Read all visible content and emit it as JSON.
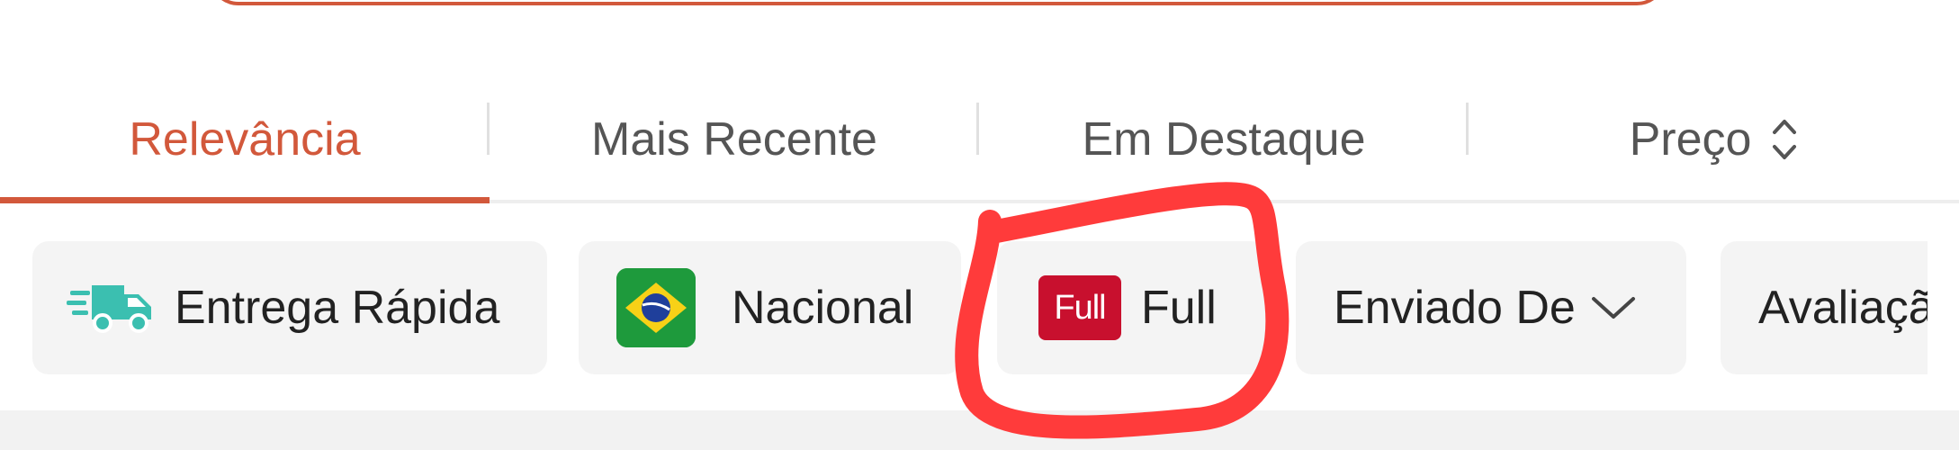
{
  "sort_tabs": {
    "items": [
      {
        "label": "Relevância",
        "active": true
      },
      {
        "label": "Mais Recente",
        "active": false
      },
      {
        "label": "Em Destaque",
        "active": false
      },
      {
        "label": "Preço",
        "active": false,
        "icon": "sort-updown-icon"
      }
    ]
  },
  "filters": {
    "chips": [
      {
        "label": "Entrega Rápida",
        "icon": "fast-delivery-truck-icon"
      },
      {
        "label": "Nacional",
        "icon": "brazil-flag-icon"
      },
      {
        "label": "Full",
        "icon": "full-badge-icon",
        "badge_text": "Full"
      },
      {
        "label": "Enviado De",
        "icon": "chevron-down-icon"
      },
      {
        "label": "Avaliaçã"
      }
    ]
  },
  "colors": {
    "accent": "#d2583b",
    "annotation": "#ff3b3b",
    "full_badge": "#c8102e",
    "chip_bg": "#f4f4f4",
    "truck_icon": "#3bbfb0"
  }
}
